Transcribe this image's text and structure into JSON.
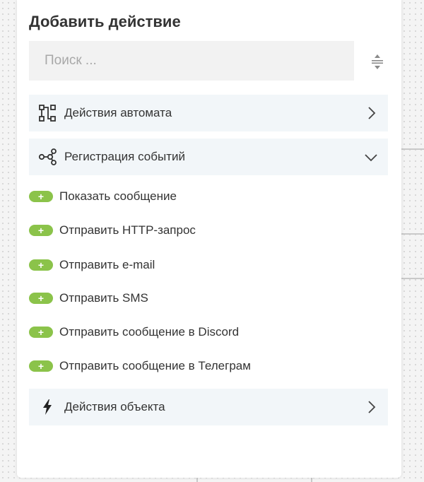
{
  "panel": {
    "title": "Добавить действие",
    "search_placeholder": "Поиск ..."
  },
  "groups": [
    {
      "label": "Действия автомата",
      "icon": "workflow-icon",
      "state": "collapsed"
    },
    {
      "label": "Регистрация событий",
      "icon": "share-nodes-icon",
      "state": "expanded"
    },
    {
      "label": "Действия объекта",
      "icon": "lightning-icon",
      "state": "collapsed"
    }
  ],
  "items": [
    {
      "label": "Показать сообщение",
      "badge": "+"
    },
    {
      "label": "Отправить HTTP-запрос",
      "badge": "+"
    },
    {
      "label": "Отправить e-mail",
      "badge": "+"
    },
    {
      "label": "Отправить SMS",
      "badge": "+"
    },
    {
      "label": "Отправить сообщение в Discord",
      "badge": "+"
    },
    {
      "label": "Отправить сообщение в Телеграм",
      "badge": "+"
    }
  ],
  "colors": {
    "badge_green": "#8bc34a",
    "group_background": "#f2f6f9",
    "search_background": "#f2f2f2",
    "text": "#333333"
  }
}
